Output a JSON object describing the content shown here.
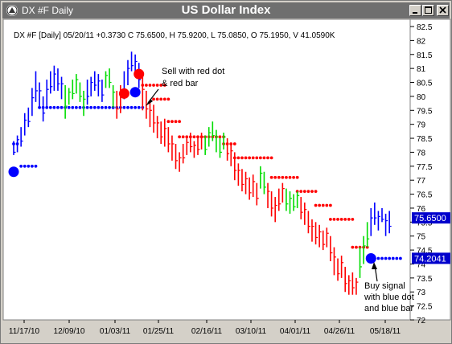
{
  "window": {
    "title": "DX #F Daily",
    "chart_title": "US Dollar Index",
    "buttons": [
      "minimize",
      "maximize",
      "close"
    ]
  },
  "info_line": "DX #F [Daily] 05/20/11  +0.3730 C 75.6500, H 75.9200, L 75.0850, O 75.1950, V 41.0590K",
  "annotations": {
    "sell": [
      "Sell with red dot",
      "& red bar"
    ],
    "buy": [
      "Buy signal",
      "with blue dot",
      "and blue bar"
    ]
  },
  "chart_data": {
    "type": "bar",
    "y_ticks": [
      "82.5",
      "82",
      "81.5",
      "81",
      "80.5",
      "80",
      "79.5",
      "79",
      "78.5",
      "78",
      "77.5",
      "77",
      "76.5",
      "76",
      "75.5",
      "75",
      "74.5",
      "74",
      "73.5",
      "73",
      "72.5",
      "72"
    ],
    "x_ticks": [
      "11/17/10",
      "12/09/10",
      "01/03/11",
      "01/25/11",
      "02/16/11",
      "03/10/11",
      "04/01/11",
      "04/26/11",
      "05/18/11"
    ],
    "ylim": [
      72,
      82.5
    ],
    "price_labels": [
      {
        "value": 75.65,
        "label": "75.6500"
      },
      {
        "value": 74.2041,
        "label": "74.2041"
      }
    ],
    "colors": {
      "up": "#00dd00",
      "down": "#ff0000",
      "neutral": "#0000ff",
      "bg": "#ffffff"
    },
    "bars": [
      {
        "h": 78.4,
        "l": 77.9,
        "c": "b"
      },
      {
        "h": 78.6,
        "l": 78.0,
        "c": "b"
      },
      {
        "h": 78.9,
        "l": 78.2,
        "c": "b"
      },
      {
        "h": 79.4,
        "l": 78.6,
        "c": "b"
      },
      {
        "h": 79.6,
        "l": 78.9,
        "c": "b"
      },
      {
        "h": 80.3,
        "l": 79.3,
        "c": "b"
      },
      {
        "h": 80.9,
        "l": 79.8,
        "c": "b"
      },
      {
        "h": 80.5,
        "l": 79.6,
        "c": "b"
      },
      {
        "h": 80.0,
        "l": 79.1,
        "c": "b"
      },
      {
        "h": 80.6,
        "l": 79.6,
        "c": "b"
      },
      {
        "h": 80.9,
        "l": 80.1,
        "c": "b"
      },
      {
        "h": 81.1,
        "l": 80.2,
        "c": "b"
      },
      {
        "h": 81.0,
        "l": 80.2,
        "c": "b"
      },
      {
        "h": 80.7,
        "l": 79.9,
        "c": "b"
      },
      {
        "h": 80.4,
        "l": 79.2,
        "c": "g"
      },
      {
        "h": 80.3,
        "l": 79.7,
        "c": "g"
      },
      {
        "h": 80.6,
        "l": 79.9,
        "c": "g"
      },
      {
        "h": 80.8,
        "l": 80.1,
        "c": "g"
      },
      {
        "h": 80.5,
        "l": 79.8,
        "c": "g"
      },
      {
        "h": 80.2,
        "l": 79.3,
        "c": "g"
      },
      {
        "h": 80.6,
        "l": 79.7,
        "c": "b"
      },
      {
        "h": 80.7,
        "l": 80.0,
        "c": "b"
      },
      {
        "h": 80.9,
        "l": 80.2,
        "c": "b"
      },
      {
        "h": 80.8,
        "l": 80.0,
        "c": "b"
      },
      {
        "h": 80.6,
        "l": 79.8,
        "c": "b"
      },
      {
        "h": 80.9,
        "l": 80.3,
        "c": "g"
      },
      {
        "h": 81.0,
        "l": 80.3,
        "c": "g"
      },
      {
        "h": 80.4,
        "l": 79.6,
        "c": "g"
      },
      {
        "h": 80.2,
        "l": 79.2,
        "c": "r"
      },
      {
        "h": 80.4,
        "l": 79.4,
        "c": "r"
      },
      {
        "h": 80.9,
        "l": 79.9,
        "c": "b"
      },
      {
        "h": 81.3,
        "l": 80.4,
        "c": "b"
      },
      {
        "h": 81.6,
        "l": 80.9,
        "c": "b"
      },
      {
        "h": 81.5,
        "l": 80.7,
        "c": "b"
      },
      {
        "h": 81.2,
        "l": 80.3,
        "c": "b"
      },
      {
        "h": 80.7,
        "l": 79.5,
        "c": "r"
      },
      {
        "h": 80.2,
        "l": 79.2,
        "c": "r"
      },
      {
        "h": 79.8,
        "l": 78.9,
        "c": "r"
      },
      {
        "h": 79.7,
        "l": 78.7,
        "c": "r"
      },
      {
        "h": 79.3,
        "l": 78.5,
        "c": "r"
      },
      {
        "h": 79.1,
        "l": 78.3,
        "c": "r"
      },
      {
        "h": 79.2,
        "l": 78.2,
        "c": "r"
      },
      {
        "h": 78.9,
        "l": 78.0,
        "c": "r"
      },
      {
        "h": 78.6,
        "l": 77.7,
        "c": "r"
      },
      {
        "h": 78.3,
        "l": 77.4,
        "c": "r"
      },
      {
        "h": 78.0,
        "l": 77.3,
        "c": "r"
      },
      {
        "h": 78.3,
        "l": 77.6,
        "c": "r"
      },
      {
        "h": 78.5,
        "l": 77.9,
        "c": "r"
      },
      {
        "h": 78.7,
        "l": 78.0,
        "c": "r"
      },
      {
        "h": 78.4,
        "l": 77.8,
        "c": "r"
      },
      {
        "h": 78.6,
        "l": 77.9,
        "c": "r"
      },
      {
        "h": 78.7,
        "l": 78.1,
        "c": "r"
      },
      {
        "h": 78.6,
        "l": 77.9,
        "c": "g"
      },
      {
        "h": 78.9,
        "l": 78.2,
        "c": "g"
      },
      {
        "h": 79.1,
        "l": 78.4,
        "c": "g"
      },
      {
        "h": 78.8,
        "l": 78.0,
        "c": "g"
      },
      {
        "h": 78.5,
        "l": 77.8,
        "c": "g"
      },
      {
        "h": 78.7,
        "l": 78.1,
        "c": "g"
      },
      {
        "h": 78.5,
        "l": 77.7,
        "c": "r"
      },
      {
        "h": 78.3,
        "l": 77.5,
        "c": "r"
      },
      {
        "h": 78.0,
        "l": 77.0,
        "c": "r"
      },
      {
        "h": 77.6,
        "l": 76.8,
        "c": "r"
      },
      {
        "h": 77.4,
        "l": 76.6,
        "c": "r"
      },
      {
        "h": 77.3,
        "l": 76.5,
        "c": "r"
      },
      {
        "h": 77.1,
        "l": 76.3,
        "c": "r"
      },
      {
        "h": 77.2,
        "l": 76.4,
        "c": "r"
      },
      {
        "h": 76.9,
        "l": 76.1,
        "c": "r"
      },
      {
        "h": 77.5,
        "l": 76.7,
        "c": "g"
      },
      {
        "h": 77.3,
        "l": 76.5,
        "c": "g"
      },
      {
        "h": 76.9,
        "l": 76.0,
        "c": "r"
      },
      {
        "h": 76.6,
        "l": 75.7,
        "c": "r"
      },
      {
        "h": 76.4,
        "l": 75.5,
        "c": "r"
      },
      {
        "h": 76.7,
        "l": 75.9,
        "c": "r"
      },
      {
        "h": 76.9,
        "l": 76.2,
        "c": "r"
      },
      {
        "h": 76.7,
        "l": 75.9,
        "c": "g"
      },
      {
        "h": 76.6,
        "l": 75.8,
        "c": "g"
      },
      {
        "h": 76.5,
        "l": 75.9,
        "c": "g"
      },
      {
        "h": 76.6,
        "l": 76.0,
        "c": "g"
      },
      {
        "h": 76.4,
        "l": 75.6,
        "c": "r"
      },
      {
        "h": 76.2,
        "l": 75.4,
        "c": "r"
      },
      {
        "h": 75.9,
        "l": 75.1,
        "c": "r"
      },
      {
        "h": 75.6,
        "l": 74.8,
        "c": "r"
      },
      {
        "h": 75.5,
        "l": 74.7,
        "c": "r"
      },
      {
        "h": 75.4,
        "l": 74.6,
        "c": "r"
      },
      {
        "h": 75.2,
        "l": 74.5,
        "c": "r"
      },
      {
        "h": 75.3,
        "l": 74.6,
        "c": "r"
      },
      {
        "h": 75.0,
        "l": 74.1,
        "c": "r"
      },
      {
        "h": 74.6,
        "l": 73.6,
        "c": "r"
      },
      {
        "h": 74.2,
        "l": 73.4,
        "c": "r"
      },
      {
        "h": 74.3,
        "l": 73.5,
        "c": "r"
      },
      {
        "h": 73.9,
        "l": 73.0,
        "c": "r"
      },
      {
        "h": 73.6,
        "l": 72.9,
        "c": "r"
      },
      {
        "h": 73.7,
        "l": 72.9,
        "c": "r"
      },
      {
        "h": 73.5,
        "l": 72.9,
        "c": "r"
      },
      {
        "h": 74.6,
        "l": 73.5,
        "c": "g"
      },
      {
        "h": 75.0,
        "l": 74.0,
        "c": "g"
      },
      {
        "h": 75.5,
        "l": 74.6,
        "c": "g"
      },
      {
        "h": 76.0,
        "l": 75.0,
        "c": "b"
      },
      {
        "h": 76.2,
        "l": 75.4,
        "c": "b"
      },
      {
        "h": 75.9,
        "l": 75.2,
        "c": "b"
      },
      {
        "h": 76.0,
        "l": 75.5,
        "c": "b"
      },
      {
        "h": 75.8,
        "l": 75.0,
        "c": "b"
      },
      {
        "h": 75.9,
        "l": 75.1,
        "c": "b"
      }
    ],
    "stops_blue": [
      {
        "from": 0,
        "to": 1,
        "v": 78.3
      },
      {
        "from": 2,
        "to": 6,
        "v": 77.5
      },
      {
        "from": 7,
        "to": 27,
        "v": 79.6
      },
      {
        "from": 27,
        "to": 35,
        "v": 79.6
      },
      {
        "from": 97,
        "to": 105,
        "v": 74.2
      }
    ],
    "stops_red": [
      {
        "from": 35,
        "to": 41,
        "v": 80.4
      },
      {
        "from": 38,
        "to": 42,
        "v": 79.9
      },
      {
        "from": 42,
        "to": 45,
        "v": 79.1
      },
      {
        "from": 45,
        "to": 57,
        "v": 78.55
      },
      {
        "from": 57,
        "to": 60,
        "v": 78.3
      },
      {
        "from": 60,
        "to": 70,
        "v": 77.8
      },
      {
        "from": 70,
        "to": 77,
        "v": 77.1
      },
      {
        "from": 77,
        "to": 82,
        "v": 76.6
      },
      {
        "from": 82,
        "to": 86,
        "v": 76.1
      },
      {
        "from": 86,
        "to": 92,
        "v": 75.6
      },
      {
        "from": 92,
        "to": 96,
        "v": 74.6
      }
    ],
    "signals": [
      {
        "bar": 0,
        "v": 77.3,
        "color": "blue"
      },
      {
        "bar": 30,
        "v": 80.1,
        "color": "red"
      },
      {
        "bar": 34,
        "v": 80.8,
        "color": "red"
      },
      {
        "bar": 33,
        "v": 80.15,
        "color": "blue"
      },
      {
        "bar": 97,
        "v": 74.2,
        "color": "blue"
      }
    ]
  }
}
